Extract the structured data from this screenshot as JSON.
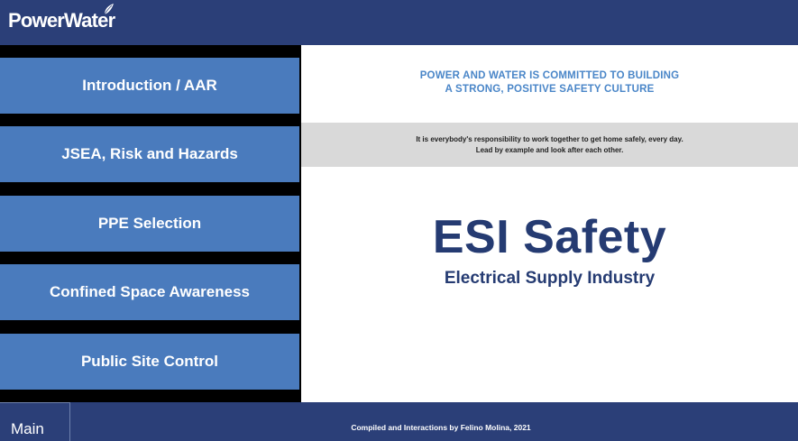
{
  "header": {
    "brand": "PowerWater",
    "logo_icon": "leaf-icon"
  },
  "nav": {
    "items": [
      {
        "label": "Introduction / AAR"
      },
      {
        "label": "JSEA, Risk and Hazards"
      },
      {
        "label": "PPE Selection"
      },
      {
        "label": "Confined Space Awareness"
      },
      {
        "label": "Public Site Control"
      }
    ]
  },
  "content": {
    "commitment_line1": "POWER AND WATER IS COMMITTED TO BUILDING",
    "commitment_line2": "A STRONG, POSITIVE SAFETY CULTURE",
    "responsibility_line1": "It is everybody's responsibility to work together to get home safely, every day.",
    "responsibility_line2": "Lead by example and look after each other.",
    "title": "ESI Safety",
    "subtitle": "Electrical Supply Industry"
  },
  "footer": {
    "main_tab": "Main",
    "credits": "Compiled and Interactions by Felino Molina, 2021"
  },
  "colors": {
    "navy": "#2b3f78",
    "button_blue": "#4a7bbd",
    "accent_blue": "#4a86c8",
    "title_navy": "#253b72",
    "band_gray": "#d9d9d9"
  }
}
